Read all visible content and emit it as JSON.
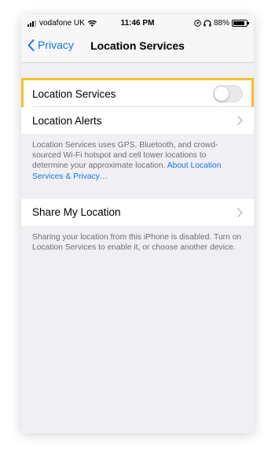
{
  "status_bar": {
    "carrier": "vodafone UK",
    "time": "11:46 PM",
    "battery_percent": "88%",
    "battery_level": 0.88,
    "icons": [
      "signal-icon",
      "wifi-icon",
      "location-arrow-icon",
      "headphones-icon",
      "battery-icon"
    ]
  },
  "nav": {
    "back_label": "Privacy",
    "title": "Location Services"
  },
  "location_services": {
    "label": "Location Services",
    "toggle_on": false
  },
  "location_alerts": {
    "label": "Location Alerts"
  },
  "location_footnote": {
    "text": "Location Services uses GPS, Bluetooth, and crowd-sourced Wi-Fi hotspot and cell tower locations to determine your approximate location.",
    "link": "About Location Services & Privacy…"
  },
  "share_location": {
    "label": "Share My Location"
  },
  "share_footnote": {
    "text": "Sharing your location from this iPhone is disabled. Turn on Location Services to enable it, or choose another device."
  },
  "colors": {
    "accent": "#1a73e8",
    "highlight": "#f4bf2c",
    "background": "#efeff4"
  }
}
